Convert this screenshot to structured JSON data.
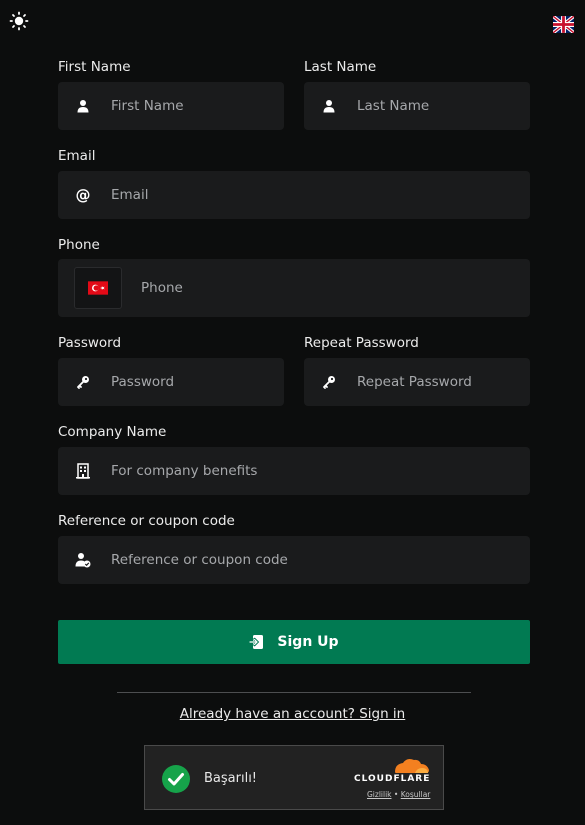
{
  "header": {
    "theme_icon": "sun-icon",
    "language_icon": "uk-flag-icon"
  },
  "form": {
    "first_name": {
      "label": "First Name",
      "placeholder": "First Name",
      "icon": "user-icon"
    },
    "last_name": {
      "label": "Last Name",
      "placeholder": "Last Name",
      "icon": "user-icon"
    },
    "email": {
      "label": "Email",
      "placeholder": "Email",
      "icon": "at-icon"
    },
    "phone": {
      "label": "Phone",
      "placeholder": "Phone",
      "country_icon": "turkey-flag-icon"
    },
    "password": {
      "label": "Password",
      "placeholder": "Password",
      "icon": "key-icon"
    },
    "repeat_password": {
      "label": "Repeat Password",
      "placeholder": "Repeat Password",
      "icon": "key-icon"
    },
    "company": {
      "label": "Company Name",
      "placeholder": "For company benefits",
      "icon": "building-icon"
    },
    "reference": {
      "label": "Reference or coupon code",
      "placeholder": "Reference or coupon code",
      "icon": "user-check-icon"
    }
  },
  "actions": {
    "signup_label": "Sign Up",
    "signin_link": "Already have an account? Sign in"
  },
  "captcha": {
    "status": "Başarılı!",
    "provider": "CLOUDFLARE",
    "privacy": "Gizlilik",
    "separator": "•",
    "terms": "Koşullar"
  },
  "colors": {
    "background": "#0c0d0d",
    "field": "#1a1b1c",
    "primary": "#017a52",
    "cloudflare_orange": "#f38020",
    "success": "#16a34a"
  }
}
